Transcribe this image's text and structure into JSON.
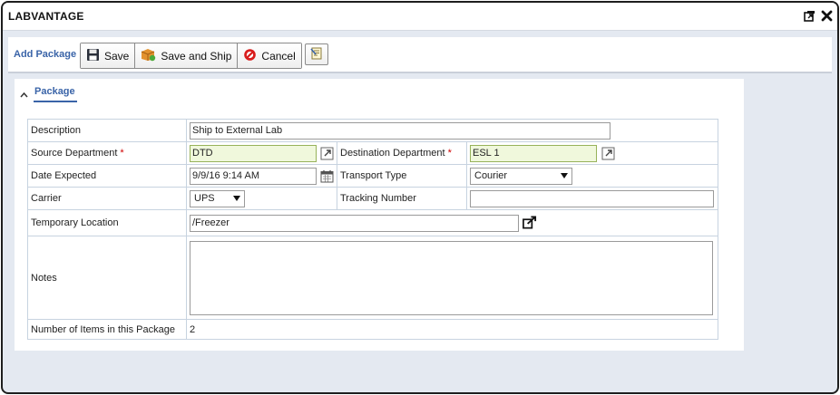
{
  "window": {
    "title": "LABVANTAGE"
  },
  "toolbar": {
    "title": "Add Package",
    "save_label": "Save",
    "save_ship_label": "Save and Ship",
    "cancel_label": "Cancel"
  },
  "panel": {
    "tab_label": "Package"
  },
  "form": {
    "description": {
      "label": "Description",
      "value": "Ship to External Lab"
    },
    "source_department": {
      "label": "Source Department",
      "required": "*",
      "value": "DTD"
    },
    "destination_department": {
      "label": "Destination Department",
      "required": "*",
      "value": "ESL 1"
    },
    "date_expected": {
      "label": "Date Expected",
      "value": "9/9/16 9:14 AM"
    },
    "transport_type": {
      "label": "Transport Type",
      "value": "Courier"
    },
    "carrier": {
      "label": "Carrier",
      "value": "UPS"
    },
    "tracking_number": {
      "label": "Tracking Number",
      "value": ""
    },
    "temporary_location": {
      "label": "Temporary Location",
      "value": "/Freezer"
    },
    "notes": {
      "label": "Notes",
      "value": ""
    },
    "num_items": {
      "label": "Number of Items in this Package",
      "value": "2"
    }
  },
  "colors": {
    "accent": "#3a64a8",
    "required": "#d00000",
    "highlight_field": "#f0f8dc"
  },
  "icons": [
    "restore-window-icon",
    "close-icon",
    "save-disk-icon",
    "box-ship-icon",
    "cancel-icon",
    "notepad-icon",
    "chevron-up-icon",
    "open-link-icon",
    "calendar-icon",
    "dropdown-arrow-icon"
  ]
}
